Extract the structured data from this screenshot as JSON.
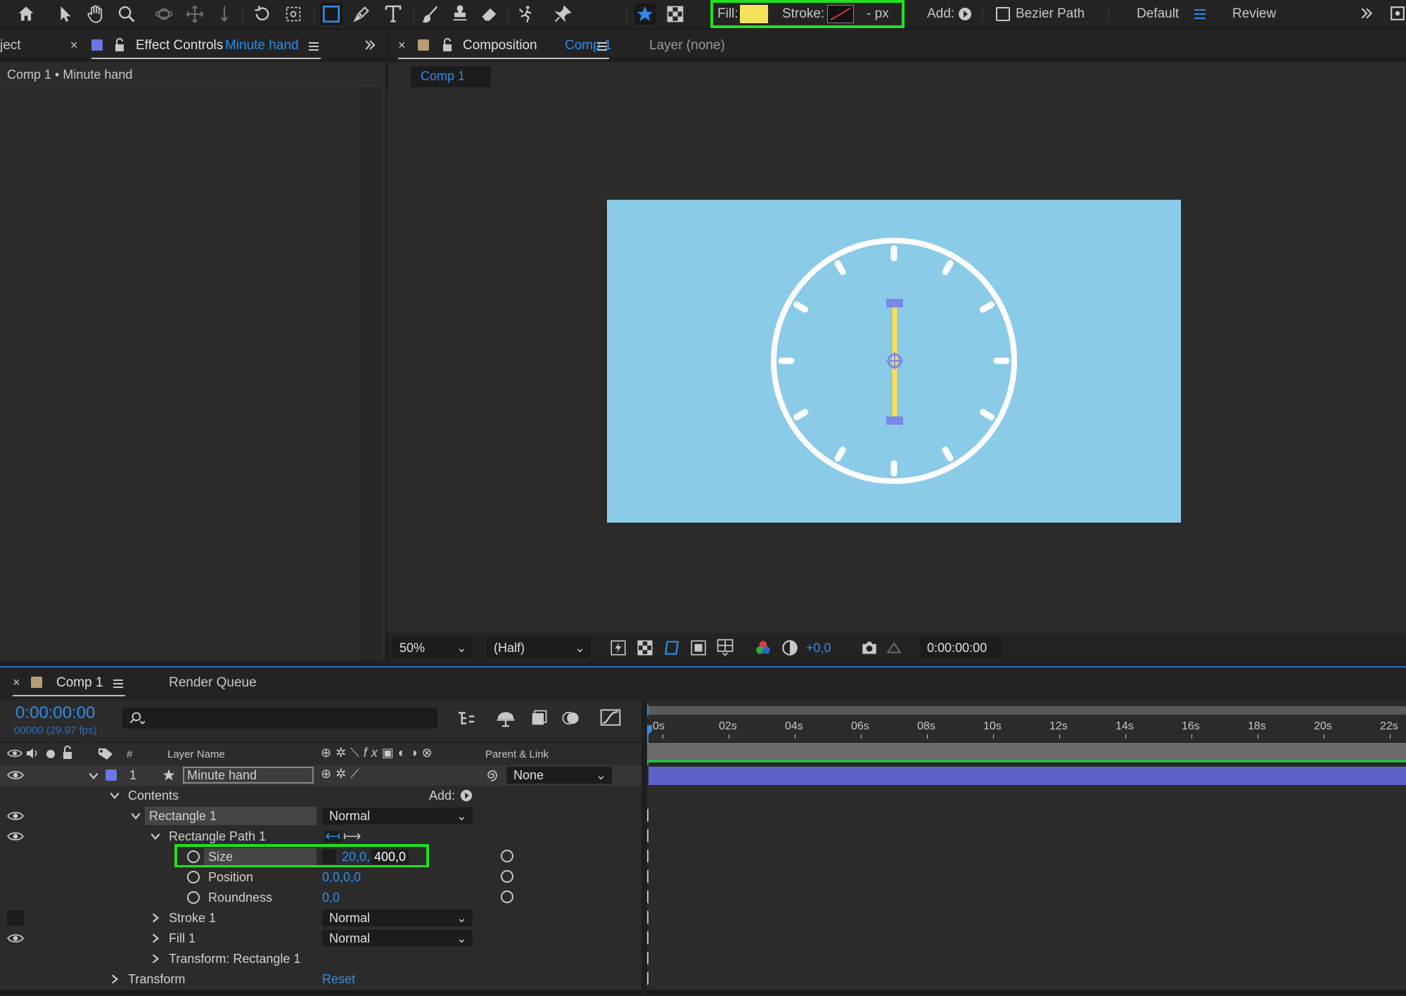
{
  "toolbar": {
    "fill_label": "Fill:",
    "stroke_label": "Stroke:",
    "stroke_width": "- px",
    "add_label": "Add:",
    "bezier_label": "Bezier Path",
    "workspace": "Default",
    "review": "Review",
    "fill_color": "#f4e35a"
  },
  "left_panel": {
    "cut_tab": "ject",
    "effect_controls_label": "Effect Controls",
    "effect_controls_target": "Minute hand",
    "subtitle": "Comp 1 • Minute hand"
  },
  "comp_panel": {
    "tab_label": "Composition",
    "tab_target": "Comp 1",
    "layer_tab": "Layer (none)",
    "comp_chip": "Comp 1",
    "zoom": "50%",
    "resolution": "(Half)",
    "exposure": "+0,0",
    "timecode": "0:00:00:00"
  },
  "canvas": {
    "background": "#8acbe8",
    "clock_color": "#ffffff",
    "hand_color": "#f4e35a",
    "handle_color": "#7a86e8"
  },
  "timeline": {
    "tab_label": "Comp 1",
    "render_queue": "Render Queue",
    "timecode": "0:00:00:00",
    "frame_info": "00000 (29.97 fps)",
    "columns": {
      "number": "#",
      "layer_name": "Layer Name",
      "parent": "Parent & Link"
    },
    "ruler": [
      "0s",
      "02s",
      "04s",
      "06s",
      "08s",
      "10s",
      "12s",
      "14s",
      "16s",
      "18s",
      "20s",
      "22s"
    ],
    "layer": {
      "index": "1",
      "name": "Minute hand",
      "parent": "None",
      "color": "#6b76e0"
    },
    "contents": "Contents",
    "add_label": "Add:",
    "rectangle": "Rectangle 1",
    "rectangle_mode": "Normal",
    "rect_path": "Rectangle Path 1",
    "size_label": "Size",
    "size_value_a": "20,0,",
    "size_value_b": "400,0",
    "position_label": "Position",
    "position_value": "0,0,0,0",
    "roundness_label": "Roundness",
    "roundness_value": "0,0",
    "stroke": "Stroke 1",
    "stroke_mode": "Normal",
    "fill": "Fill 1",
    "fill_mode": "Normal",
    "transform_rect": "Transform: Rectangle 1",
    "transform": "Transform",
    "reset": "Reset"
  }
}
